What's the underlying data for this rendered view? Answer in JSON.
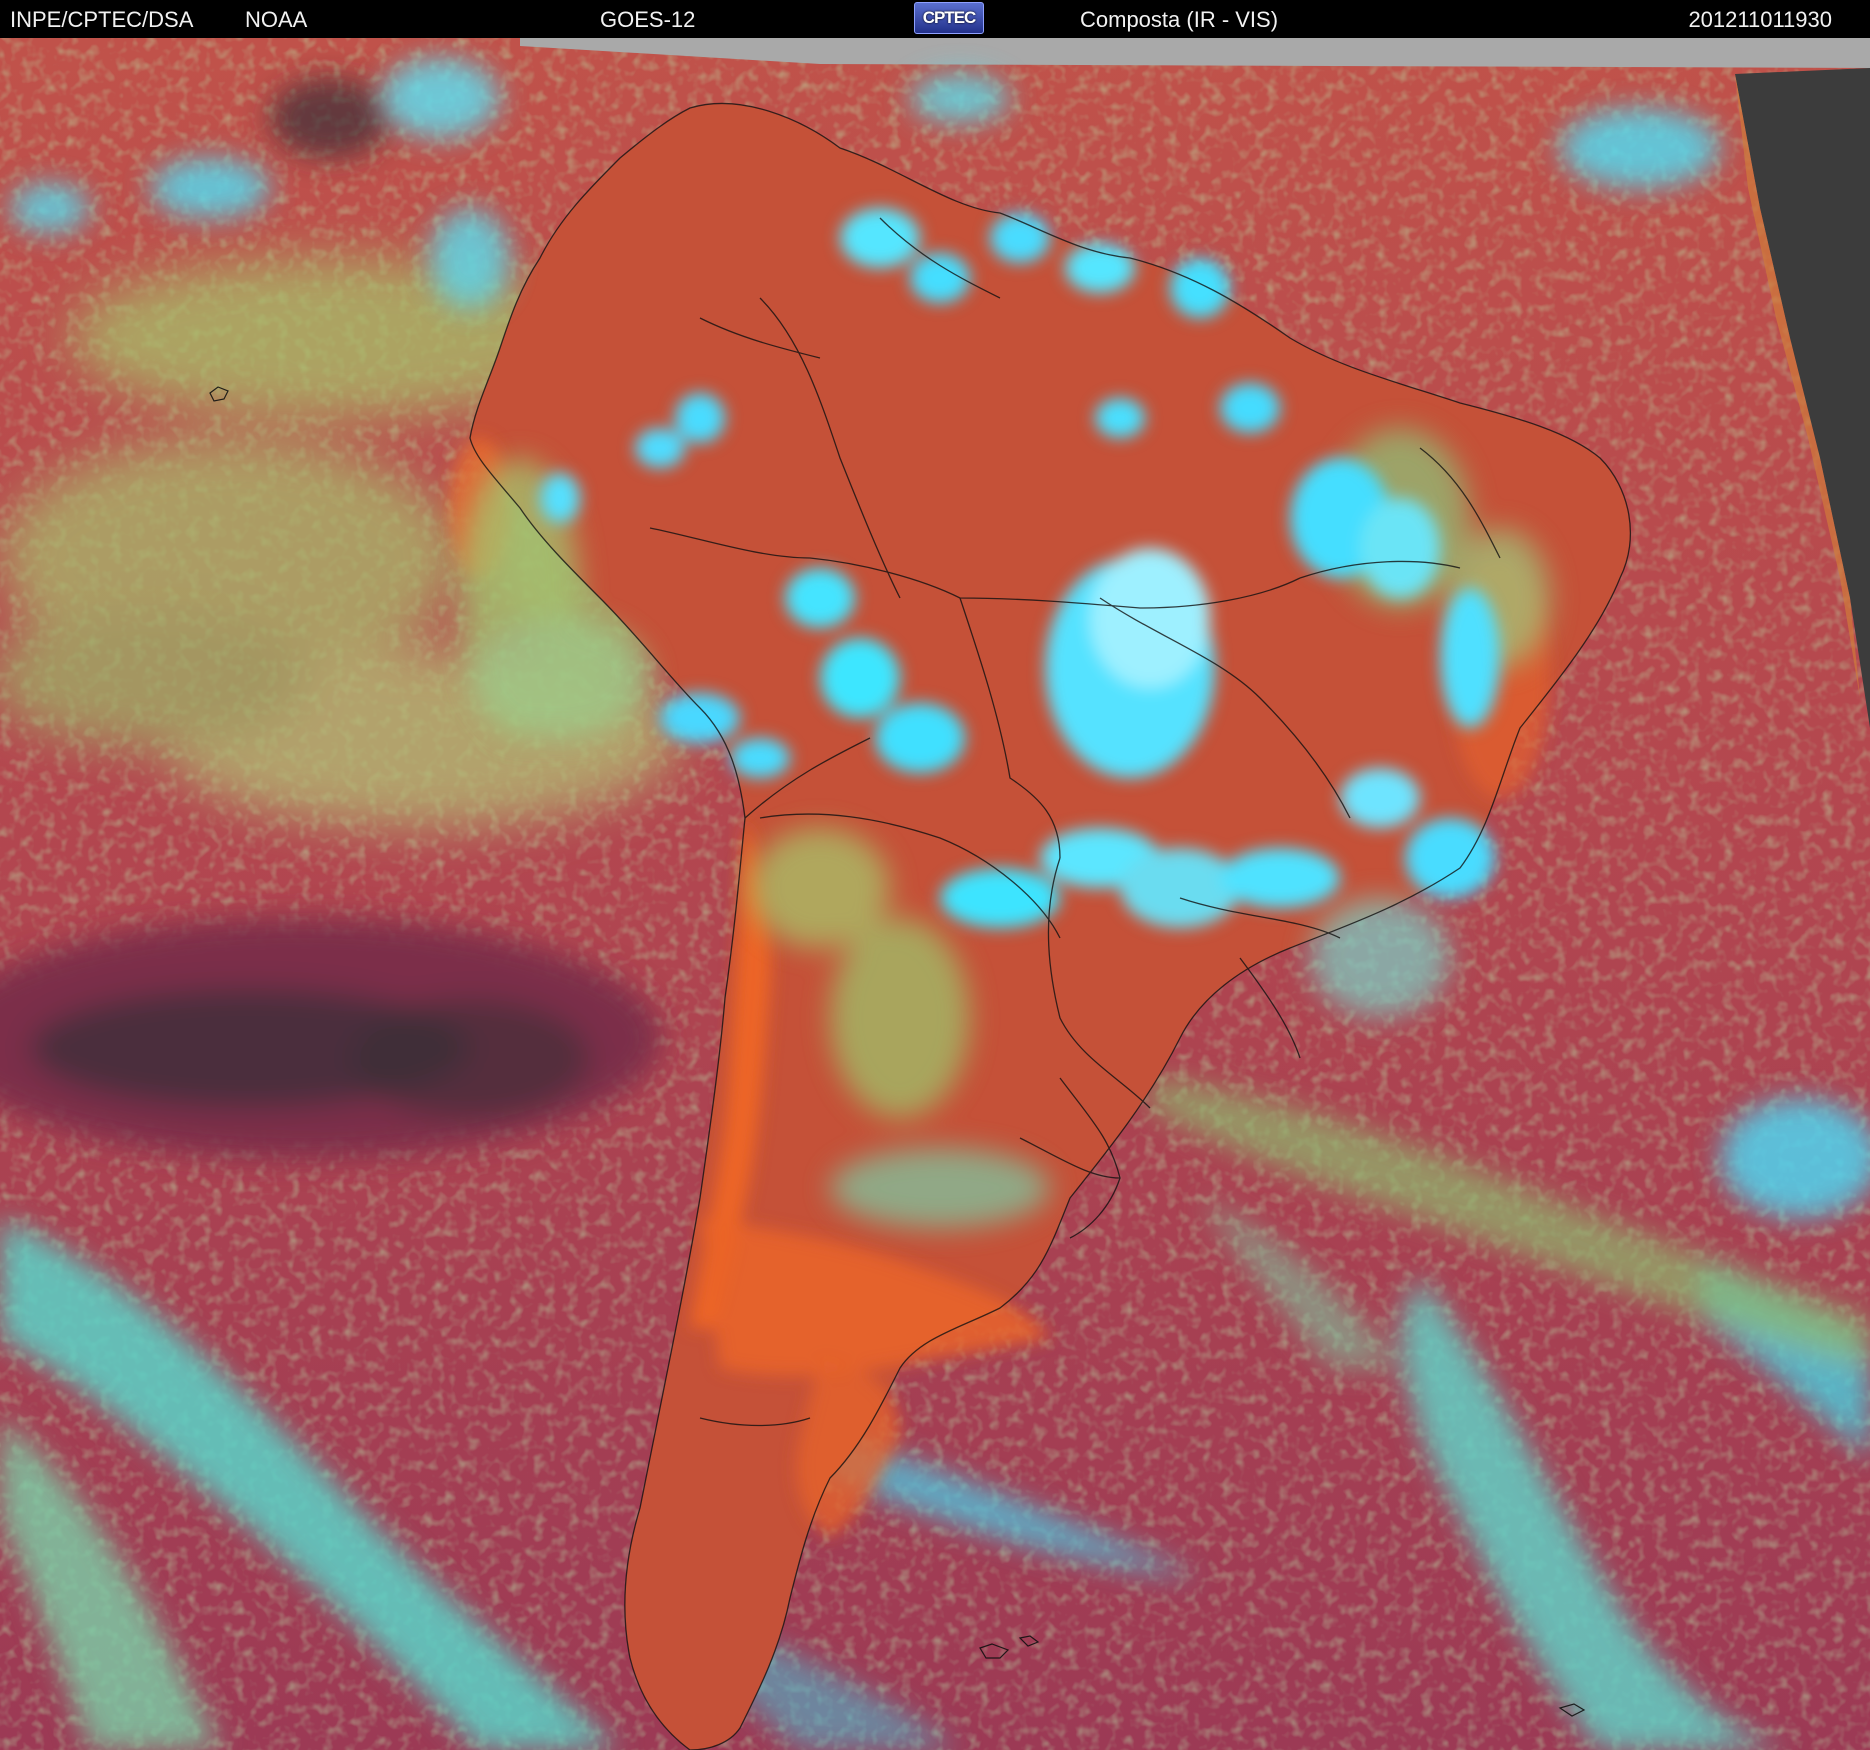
{
  "header": {
    "org": "INPE/CPTEC/DSA",
    "agency": "NOAA",
    "satellite": "GOES-12",
    "logo_text": "CPTEC",
    "product": "Composta (IR - VIS)",
    "timestamp": "201211011930"
  },
  "colors": {
    "header_bg": "#000000",
    "header_text": "#f2f2f2",
    "ocean_base": "#b24a4e",
    "land_warm": "#c9553a",
    "desert_orange": "#e8632a",
    "deep_cloud": "#3fe6ff",
    "low_cloud": "#a8c96a",
    "clear_cold_ocean": "#7a2e48",
    "night_side": "#3a3a3a",
    "no_data": "#a9a9a9",
    "borders": "#111111"
  },
  "image": {
    "description_icon": "satellite-composite-image"
  }
}
